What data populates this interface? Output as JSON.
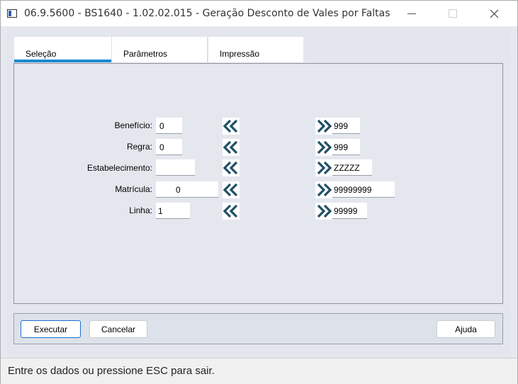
{
  "window": {
    "title": "06.9.5600 - BS1640 - 1.02.02.015 - Geração Desconto de Vales por Faltas",
    "controls": {
      "minimize": "—",
      "maximize": "□",
      "close": "✕"
    }
  },
  "tabs": [
    {
      "label": "Seleção",
      "active": true
    },
    {
      "label": "Parâmetros",
      "active": false
    },
    {
      "label": "Impressão",
      "active": false
    }
  ],
  "form": {
    "rows": [
      {
        "label": "Benefício:",
        "from": "0",
        "to": "999"
      },
      {
        "label": "Regra:",
        "from": "0",
        "to": "999"
      },
      {
        "label": "Estabelecimento:",
        "from": "",
        "to": "ZZZZZ"
      },
      {
        "label": "Matrícula:",
        "from": "0",
        "to": "99999999"
      },
      {
        "label": "Linha:",
        "from": "1",
        "to": "99999"
      }
    ],
    "first_icon": "double-chevron-left-icon",
    "last_icon": "double-chevron-right-icon",
    "icon_color": "#1f4f66"
  },
  "buttons": {
    "execute": "Executar",
    "cancel": "Cancelar",
    "help": "Ajuda"
  },
  "status": {
    "text": "Entre os dados ou pressione ESC para sair."
  },
  "colors": {
    "tab_indicator": "#1b8ad0",
    "primary_button_border": "#1b6fd1"
  }
}
